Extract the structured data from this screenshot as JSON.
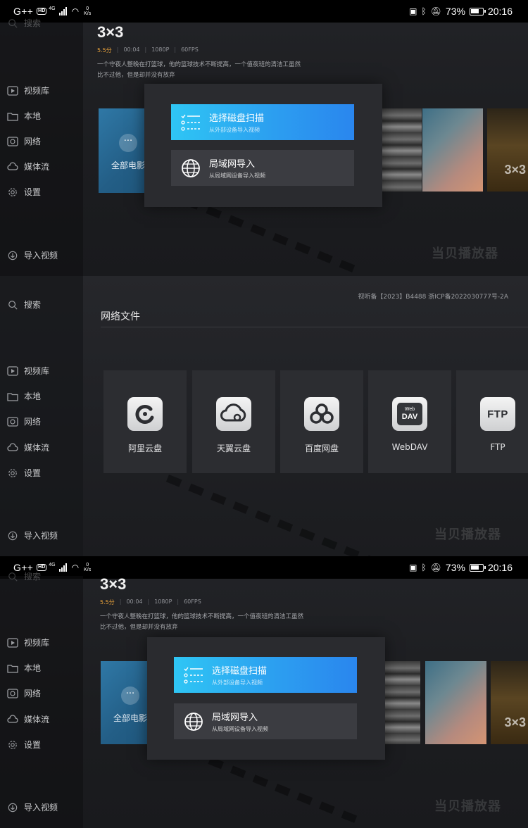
{
  "status_bar": {
    "carrier": "G++",
    "hd": "HD",
    "network_gen": "4G",
    "net_speed_value": "0",
    "net_speed_unit": "K/s",
    "battery": "73%",
    "time": "20:16"
  },
  "sidebar": {
    "search": "搜索",
    "items": [
      "视频库",
      "本地",
      "网络",
      "媒体流",
      "设置"
    ],
    "import": "导入视频"
  },
  "movie": {
    "title": "3×3",
    "score": "5.5分",
    "duration": "00:04",
    "resolution": "1080P",
    "fps": "60FPS",
    "description_line1": "一个守夜人整晚在打篮球，他的篮球技术不断提高，一个值夜班的清洁工虽然",
    "description_line2": "比不过他，但是却并没有放弃"
  },
  "all_movies_card": {
    "dots": "···",
    "label": "全部电影"
  },
  "poster_text": "3×3",
  "import_dialog": {
    "option1_title": "选择磁盘扫描",
    "option1_subtitle": "从外部设备导入视频",
    "option2_title": "局域网导入",
    "option2_subtitle": "从局域网设备导入视频"
  },
  "watermark": "当贝播放器",
  "network_page": {
    "icp": "视听备【2023】B4488   浙ICP备2022030777号-2A",
    "title": "网络文件",
    "tiles": [
      "阿里云盘",
      "天翼云盘",
      "百度网盘",
      "WebDAV",
      "FTP"
    ],
    "ftp_icon_text": "FTP",
    "webdav_icon_top": "Web",
    "webdav_icon_bottom": "DAV"
  }
}
